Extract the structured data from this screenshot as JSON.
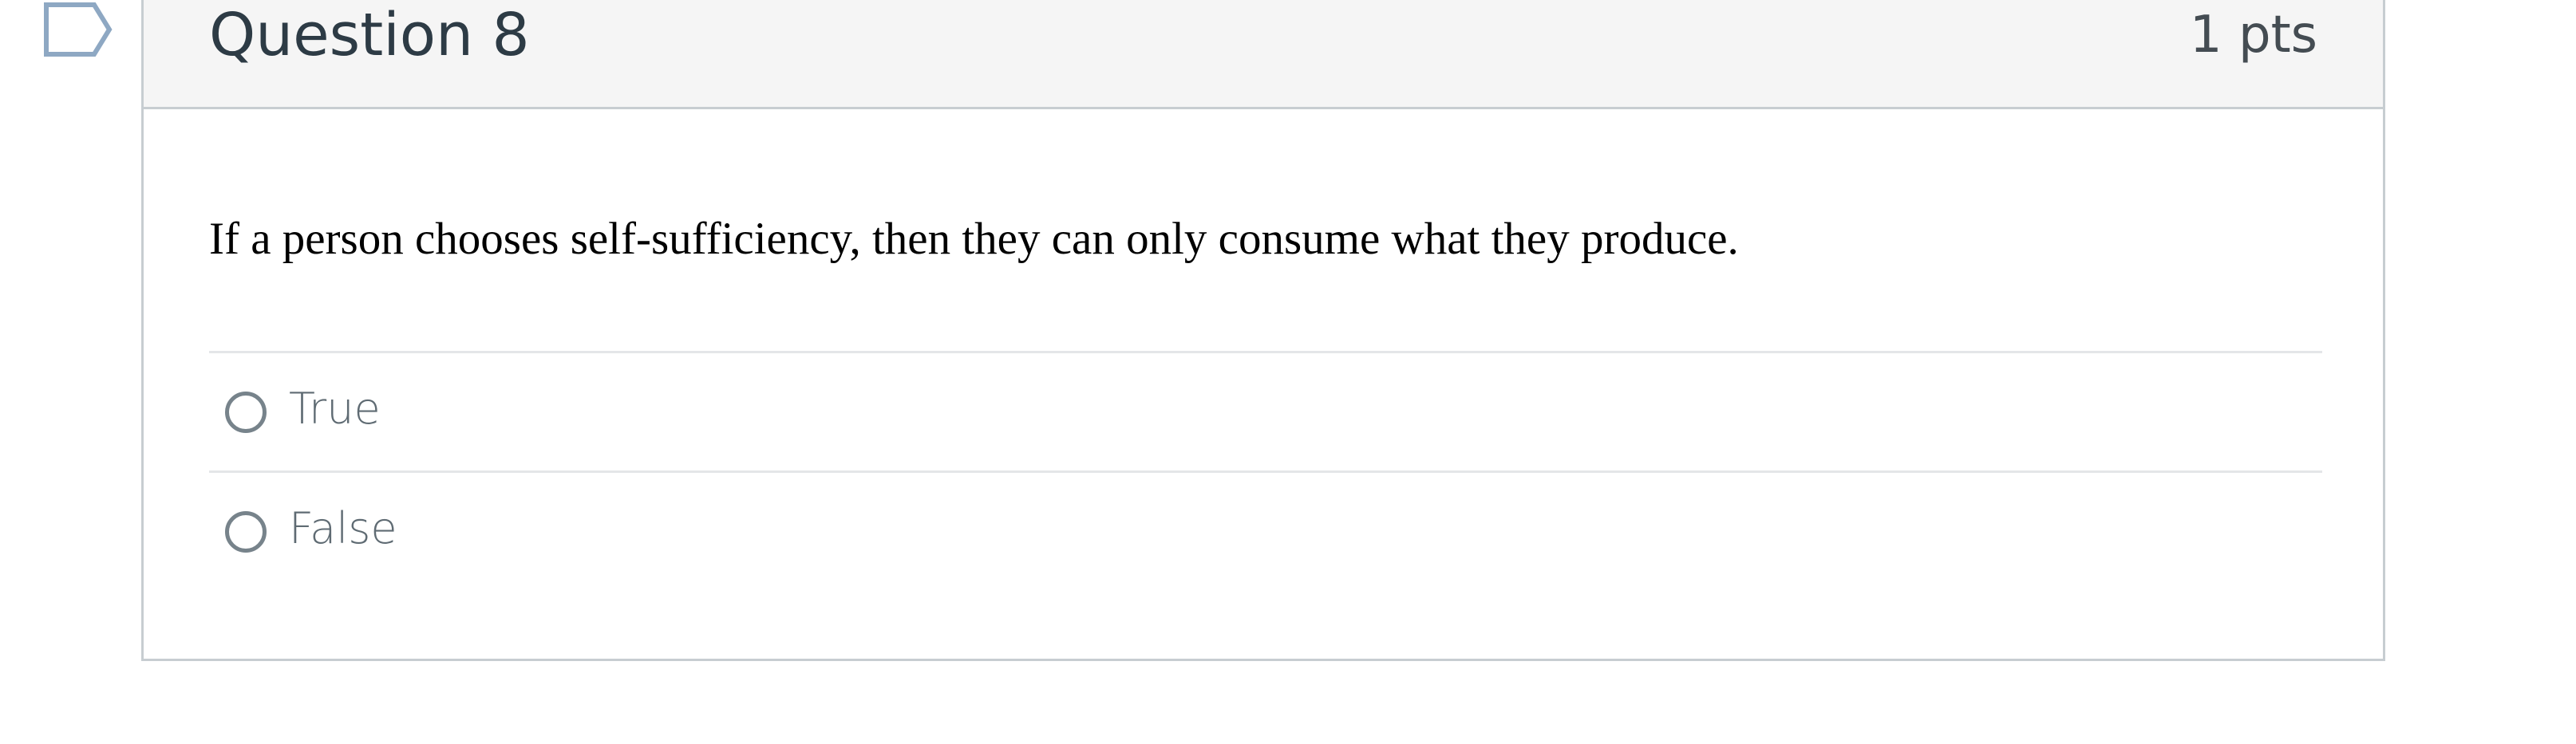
{
  "question": {
    "title": "Question 8",
    "points": "1 pts",
    "flag_icon": "flag-icon",
    "text": "If a person chooses self-sufficiency, then they can only consume what they produce.",
    "answers": [
      {
        "label": "True",
        "selected": false
      },
      {
        "label": "False",
        "selected": false
      }
    ]
  },
  "colors": {
    "header_background": "#f5f5f5",
    "border": "#c7cdd1",
    "title_text": "#2d3b45",
    "flag_outline": "#8ea8c3",
    "radio_border": "#77838b"
  }
}
